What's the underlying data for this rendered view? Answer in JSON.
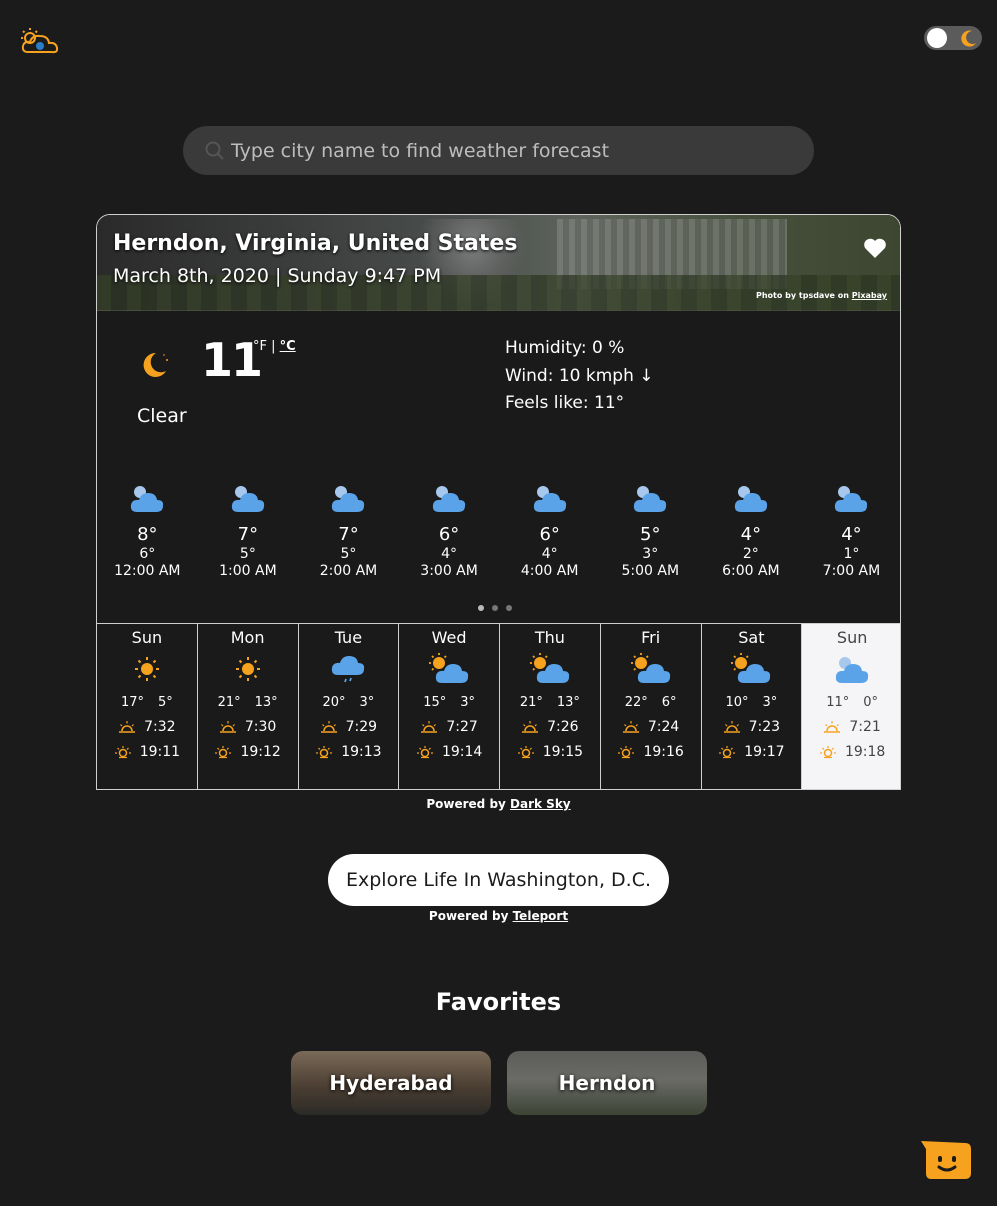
{
  "header": {
    "logo_icon": "sun-cloud-icon",
    "theme_toggle_icon": "moon-icon"
  },
  "search": {
    "placeholder": "Type city name to find weather forecast",
    "icon": "search-icon"
  },
  "location": {
    "title": "Herndon, Virginia, United States",
    "datetime": "March 8th, 2020 | Sunday 9:47 PM",
    "photo_credit_prefix": "Photo by tpsdave on",
    "photo_credit_link": "Pixabay"
  },
  "current": {
    "temp": "11",
    "unit_f": "°F",
    "unit_sep": "|",
    "unit_c": "°C",
    "condition": "Clear",
    "humidity": "Humidity:  0 %",
    "wind": "Wind: 10 kmph  ↓",
    "feels_like": "Feels like: 11°",
    "icon": "moon-icon"
  },
  "hourly": [
    {
      "hi": "8°",
      "lo": "6°",
      "time": "12:00 AM"
    },
    {
      "hi": "7°",
      "lo": "5°",
      "time": "1:00 AM"
    },
    {
      "hi": "7°",
      "lo": "5°",
      "time": "2:00 AM"
    },
    {
      "hi": "6°",
      "lo": "4°",
      "time": "3:00 AM"
    },
    {
      "hi": "6°",
      "lo": "4°",
      "time": "4:00 AM"
    },
    {
      "hi": "5°",
      "lo": "3°",
      "time": "5:00 AM"
    },
    {
      "hi": "4°",
      "lo": "2°",
      "time": "6:00 AM"
    },
    {
      "hi": "4°",
      "lo": "1°",
      "time": "7:00 AM"
    }
  ],
  "daily": [
    {
      "day": "Sun",
      "icon": "sun-icon",
      "hi": "17°",
      "lo": "5°",
      "sunrise": "7:32",
      "sunset": "19:11"
    },
    {
      "day": "Mon",
      "icon": "sun-icon",
      "hi": "21°",
      "lo": "13°",
      "sunrise": "7:30",
      "sunset": "19:12"
    },
    {
      "day": "Tue",
      "icon": "rain-cloud-icon",
      "hi": "20°",
      "lo": "3°",
      "sunrise": "7:29",
      "sunset": "19:13"
    },
    {
      "day": "Wed",
      "icon": "partly-cloudy-icon",
      "hi": "15°",
      "lo": "3°",
      "sunrise": "7:27",
      "sunset": "19:14"
    },
    {
      "day": "Thu",
      "icon": "partly-cloudy-icon",
      "hi": "21°",
      "lo": "13°",
      "sunrise": "7:26",
      "sunset": "19:15"
    },
    {
      "day": "Fri",
      "icon": "partly-cloudy-icon",
      "hi": "22°",
      "lo": "6°",
      "sunrise": "7:24",
      "sunset": "19:16"
    },
    {
      "day": "Sat",
      "icon": "partly-cloudy-icon",
      "hi": "10°",
      "lo": "3°",
      "sunrise": "7:23",
      "sunset": "19:17"
    },
    {
      "day": "Sun",
      "icon": "cloudy-icon",
      "hi": "11°",
      "lo": "0°",
      "sunrise": "7:21",
      "sunset": "19:18"
    }
  ],
  "powered_darksky": {
    "prefix": "Powered by",
    "link": "Dark Sky"
  },
  "explore": {
    "label": "Explore Life In Washington, D.C."
  },
  "powered_teleport": {
    "prefix": "Powered by",
    "link": "Teleport"
  },
  "favorites": {
    "title": "Favorites",
    "items": [
      {
        "label": "Hyderabad"
      },
      {
        "label": "Herndon"
      }
    ]
  },
  "colors": {
    "background": "#1b1b1b",
    "accent": "#f6a21e",
    "cloud": "#5ba3e8"
  }
}
